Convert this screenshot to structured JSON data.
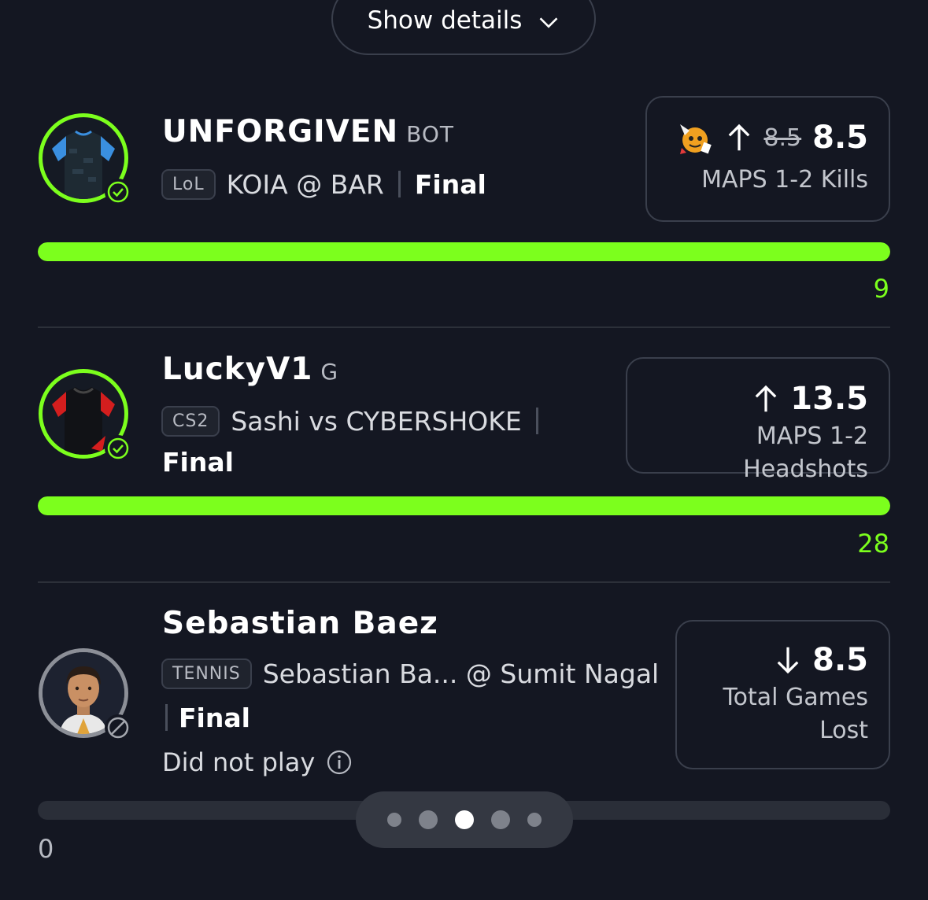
{
  "details_button": {
    "label": "Show details"
  },
  "picks": [
    {
      "name": "UNFORGIVEN",
      "position": "BOT",
      "league": "LoL",
      "matchup": "KOIA @ BAR",
      "status": "Final",
      "old_line": "8.5",
      "line": "8.5",
      "direction": "up",
      "stat": "MAPS 1-2 Kills",
      "result": "9",
      "progress_fraction": 1.0,
      "jersey_colors": {
        "body": "#1e2a33",
        "sleeves": "#3a8fe0"
      }
    },
    {
      "name": "LuckyV1",
      "position": "G",
      "league": "CS2",
      "matchup": "Sashi vs CYBERSHOKE",
      "status": "Final",
      "line": "13.5",
      "direction": "up",
      "stat": "MAPS 1-2 Headshots",
      "result": "28",
      "progress_fraction": 1.0,
      "jersey_colors": {
        "body": "#111216",
        "sleeves": "#d41e1e"
      }
    },
    {
      "name": "Sebastian Baez",
      "league": "TENNIS",
      "matchup": "Sebastian Ba... @ Sumit Nagal",
      "status": "Final",
      "line": "8.5",
      "direction": "down",
      "stat_line1": "Total Games",
      "stat_line2": "Lost",
      "note": "Did not play",
      "result": "0",
      "progress_fraction": 0.0
    }
  ],
  "pager": {
    "count": 5,
    "active_index": 2
  },
  "colors": {
    "accent": "#7cff1d",
    "background": "#141722",
    "border": "#3a3f4c"
  }
}
